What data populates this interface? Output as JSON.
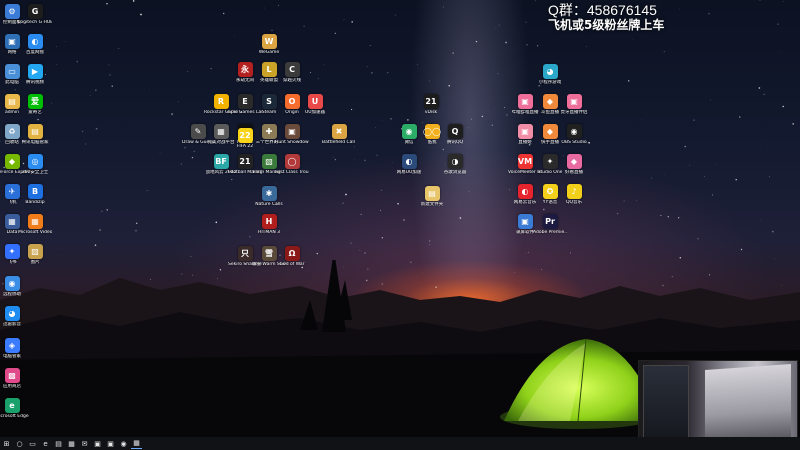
{
  "banner": {
    "line1": "Q群：458676145",
    "line2": "飞机或5级粉丝牌上车"
  },
  "desktop_icons": [
    {
      "name": "recycle-bin-like",
      "label": "控制面板",
      "color": "#3a7bd5",
      "glyph": "⚙"
    },
    {
      "name": "logitech",
      "label": "Logitech G HUB",
      "color": "#1d1d1d",
      "glyph": "G"
    },
    {
      "name": "network",
      "label": "网络",
      "color": "#2f6fb5",
      "glyph": "▣"
    },
    {
      "name": "baidu-netdisk",
      "label": "百度网盘",
      "color": "#2a8cf0",
      "glyph": "◐"
    },
    {
      "name": "computer",
      "label": "此电脑",
      "color": "#4a90d9",
      "glyph": "▭"
    },
    {
      "name": "tencent-video",
      "label": "腾讯视频",
      "color": "#22a7f0",
      "glyph": "▶"
    },
    {
      "name": "admin",
      "label": "admin",
      "color": "#e8b84a",
      "glyph": "▤"
    },
    {
      "name": "iqiyi",
      "label": "爱奇艺",
      "color": "#00be06",
      "glyph": "爱"
    },
    {
      "name": "recycle",
      "label": "回收站",
      "color": "#7fa7c9",
      "glyph": "♻"
    },
    {
      "name": "folder-a",
      "label": "腾讯电脑管家",
      "color": "#e3b341",
      "glyph": "▤"
    },
    {
      "name": "geforce",
      "label": "GeForce Experience",
      "color": "#76b900",
      "glyph": "◆"
    },
    {
      "name": "360",
      "label": "360安全卫士",
      "color": "#2a8cf0",
      "glyph": "◎"
    },
    {
      "name": "feiji",
      "label": "飞机",
      "color": "#2a6fd8",
      "glyph": "✈"
    },
    {
      "name": "bandizip",
      "label": "Bandizip",
      "color": "#1e6fe0",
      "glyph": "B"
    },
    {
      "name": "data",
      "label": "Data",
      "color": "#3a5c9a",
      "glyph": "▦"
    },
    {
      "name": "ms-video",
      "label": "Microsoft Video C...",
      "color": "#f07d1a",
      "glyph": "▦"
    },
    {
      "name": "feishu",
      "label": "飞书",
      "color": "#3370ff",
      "glyph": "✦"
    },
    {
      "name": "picture",
      "label": "图片",
      "color": "#c9a24d",
      "glyph": "▨"
    },
    {
      "name": "remote",
      "label": "远程协助",
      "color": "#3a8ee6",
      "glyph": "◉"
    },
    {
      "name": "xunlei",
      "label": "迅雷影音",
      "color": "#1e8cf0",
      "glyph": "◕"
    },
    {
      "name": "shield",
      "label": "电脑管家",
      "color": "#3a7bff",
      "glyph": "◈"
    },
    {
      "name": "apps-store",
      "label": "应用商店",
      "color": "#e04a8b",
      "glyph": "▩"
    },
    {
      "name": "edge",
      "label": "Microsoft Edge",
      "color": "#1aa06b",
      "glyph": "e"
    }
  ],
  "middle_icons": [
    {
      "name": "wechat-dev",
      "label": "WeGame",
      "color": "#d9a441",
      "glyph": "W"
    },
    {
      "name": "game-a",
      "label": "永劫无间",
      "color": "#b32020",
      "glyph": "永"
    },
    {
      "name": "game-b",
      "label": "英雄联盟",
      "color": "#c9a227",
      "glyph": "L"
    },
    {
      "name": "game-c",
      "label": "穿越火线",
      "color": "#3b3b3b",
      "glyph": "C"
    },
    {
      "name": "rockstar",
      "label": "Rockstar Games...",
      "color": "#f3b200",
      "glyph": "R"
    },
    {
      "name": "epic",
      "label": "Epic Games Launcher",
      "color": "#2a2a2a",
      "glyph": "E"
    },
    {
      "name": "steam",
      "label": "Steam",
      "color": "#1b2838",
      "glyph": "S"
    },
    {
      "name": "origin",
      "label": "Origin",
      "color": "#f56c2d",
      "glyph": "O"
    },
    {
      "name": "uu",
      "label": "UU加速器",
      "color": "#e84a4a",
      "glyph": "U"
    },
    {
      "name": "draw",
      "label": "Draw & Guess",
      "color": "#4b4b4b",
      "glyph": "✎"
    },
    {
      "name": "csgo",
      "label": "完美对战平台",
      "color": "#5a5a5a",
      "glyph": "▦"
    },
    {
      "name": "fifa",
      "label": "FIFA 22",
      "color": "#111111",
      "glyph": "21"
    },
    {
      "name": "ace",
      "label": "三个世界的...",
      "color": "#8a7a55",
      "glyph": "✚"
    },
    {
      "name": "hunt",
      "label": "Hunt Showdown",
      "color": "#6a4a3a",
      "glyph": "▣"
    },
    {
      "name": "battlefield-cod",
      "label": "Battlefield Call of D...",
      "color": "#d9a441",
      "glyph": "✖"
    },
    {
      "name": "bf-2042",
      "label": "战地风云 2042",
      "color": "#2ba7a7",
      "glyph": "BF"
    },
    {
      "name": "football-manager",
      "label": "Football Manag...",
      "color": "#222222",
      "glyph": "21"
    },
    {
      "name": "farm",
      "label": "Farm Manag...",
      "color": "#3a7a3a",
      "glyph": "▧"
    },
    {
      "name": "first-class",
      "label": "First Class Trouble",
      "color": "#b33a3a",
      "glyph": "◯"
    },
    {
      "name": "22",
      "label": "FIFA 22",
      "color": "#f7d319",
      "glyph": "22"
    },
    {
      "name": "nature",
      "label": "Nature Calls",
      "color": "#3a6a9a",
      "glyph": "✱"
    },
    {
      "name": "hitman",
      "label": "HITMAN 3",
      "color": "#b01e1e",
      "glyph": "H"
    },
    {
      "name": "sekiro",
      "label": "Sekiro Shadows...",
      "color": "#3a2a2a",
      "glyph": "只"
    },
    {
      "name": "warm-snow",
      "label": "暖雪 Warm Snow Demo",
      "color": "#5a4a3a",
      "glyph": "雪"
    },
    {
      "name": "god-of-war",
      "label": "God of War",
      "color": "#8a1a1a",
      "glyph": "Ω"
    }
  ],
  "center_icons": [
    {
      "name": "ai-21",
      "label": "vDisk",
      "color": "#1c1c1c",
      "glyph": "21"
    },
    {
      "name": "wechat",
      "label": "微信",
      "color": "#2aae67",
      "glyph": "◉"
    },
    {
      "name": "kuwo",
      "label": "酷我",
      "color": "#f2b01e",
      "glyph": "◯◯"
    },
    {
      "name": "qq",
      "label": "腾讯QQ",
      "color": "#1e1e1e",
      "glyph": "Q"
    },
    {
      "name": "voice-a",
      "label": "网易UU加速",
      "color": "#2a4a7a",
      "glyph": "◐"
    },
    {
      "name": "chrome",
      "label": "谷歌浏览器",
      "color": "#2a2a2a",
      "glyph": "◑"
    },
    {
      "name": "new-file",
      "label": "新建文件夹",
      "color": "#e8c46a",
      "glyph": "▤"
    }
  ],
  "right_icons": [
    {
      "name": "game-center",
      "label": "小程序游戏",
      "color": "#2aa7c9",
      "glyph": "◕"
    },
    {
      "name": "live-a",
      "label": "哔哩哔哩直播",
      "color": "#f06e9a",
      "glyph": "▣"
    },
    {
      "name": "live-b",
      "label": "斗鱼直播",
      "color": "#f08a3a",
      "glyph": "◆"
    },
    {
      "name": "live-c",
      "label": "虎牙直播伴侣",
      "color": "#f06e9a",
      "glyph": "▣"
    },
    {
      "name": "live-d",
      "label": "直播姬",
      "color": "#f28da8",
      "glyph": "▣"
    },
    {
      "name": "live-e",
      "label": "快手直播",
      "color": "#f08a3a",
      "glyph": "◆"
    },
    {
      "name": "obs",
      "label": "OBS Studio",
      "color": "#202020",
      "glyph": "◉"
    },
    {
      "name": "voicemeeter",
      "label": "VoiceMeeter Banana",
      "color": "#e33",
      "glyph": "VM"
    },
    {
      "name": "studio-one",
      "label": "Studio One",
      "color": "#2a2a2a",
      "glyph": "✦"
    },
    {
      "name": "game-d",
      "label": "好看直播",
      "color": "#e86aa0",
      "glyph": "◆"
    },
    {
      "name": "netease-music",
      "label": "网易云音乐",
      "color": "#e6242d",
      "glyph": "◐"
    },
    {
      "name": "yy",
      "label": "YY语音",
      "color": "#f5d01a",
      "glyph": "✪"
    },
    {
      "name": "qq-music",
      "label": "QQ音乐",
      "color": "#f2d01a",
      "glyph": "♪"
    },
    {
      "name": "record",
      "label": "录屏软件",
      "color": "#3a7bd5",
      "glyph": "▣"
    },
    {
      "name": "premiere",
      "label": "Adobe Premie...",
      "color": "#1c1a40",
      "glyph": "Pr"
    }
  ],
  "taskbar": {
    "items": [
      {
        "name": "start-icon",
        "glyph": "⊞",
        "active": false
      },
      {
        "name": "search-icon",
        "glyph": "○",
        "active": false
      },
      {
        "name": "task-view-icon",
        "glyph": "▭",
        "active": false
      },
      {
        "name": "edge-icon",
        "glyph": "e",
        "active": false
      },
      {
        "name": "explorer-icon",
        "glyph": "▤",
        "active": false
      },
      {
        "name": "store-icon",
        "glyph": "▦",
        "active": false
      },
      {
        "name": "mail-icon",
        "glyph": "✉",
        "active": false
      },
      {
        "name": "app-icon-a",
        "glyph": "▣",
        "active": false
      },
      {
        "name": "app-icon-b",
        "glyph": "▣",
        "active": false
      },
      {
        "name": "app-icon-c",
        "glyph": "◉",
        "active": false
      },
      {
        "name": "app-icon-d",
        "glyph": "▦",
        "active": true
      }
    ]
  }
}
